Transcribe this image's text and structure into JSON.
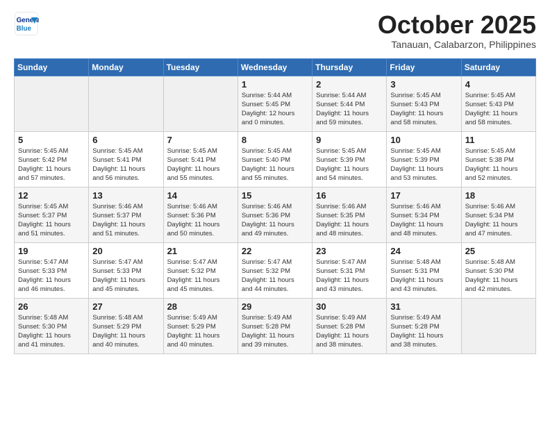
{
  "header": {
    "logo_line1": "General",
    "logo_line2": "Blue",
    "month": "October 2025",
    "location": "Tanauan, Calabarzon, Philippines"
  },
  "days_of_week": [
    "Sunday",
    "Monday",
    "Tuesday",
    "Wednesday",
    "Thursday",
    "Friday",
    "Saturday"
  ],
  "weeks": [
    [
      {
        "day": "",
        "info": ""
      },
      {
        "day": "",
        "info": ""
      },
      {
        "day": "",
        "info": ""
      },
      {
        "day": "1",
        "info": "Sunrise: 5:44 AM\nSunset: 5:45 PM\nDaylight: 12 hours\nand 0 minutes."
      },
      {
        "day": "2",
        "info": "Sunrise: 5:44 AM\nSunset: 5:44 PM\nDaylight: 11 hours\nand 59 minutes."
      },
      {
        "day": "3",
        "info": "Sunrise: 5:45 AM\nSunset: 5:43 PM\nDaylight: 11 hours\nand 58 minutes."
      },
      {
        "day": "4",
        "info": "Sunrise: 5:45 AM\nSunset: 5:43 PM\nDaylight: 11 hours\nand 58 minutes."
      }
    ],
    [
      {
        "day": "5",
        "info": "Sunrise: 5:45 AM\nSunset: 5:42 PM\nDaylight: 11 hours\nand 57 minutes."
      },
      {
        "day": "6",
        "info": "Sunrise: 5:45 AM\nSunset: 5:41 PM\nDaylight: 11 hours\nand 56 minutes."
      },
      {
        "day": "7",
        "info": "Sunrise: 5:45 AM\nSunset: 5:41 PM\nDaylight: 11 hours\nand 55 minutes."
      },
      {
        "day": "8",
        "info": "Sunrise: 5:45 AM\nSunset: 5:40 PM\nDaylight: 11 hours\nand 55 minutes."
      },
      {
        "day": "9",
        "info": "Sunrise: 5:45 AM\nSunset: 5:39 PM\nDaylight: 11 hours\nand 54 minutes."
      },
      {
        "day": "10",
        "info": "Sunrise: 5:45 AM\nSunset: 5:39 PM\nDaylight: 11 hours\nand 53 minutes."
      },
      {
        "day": "11",
        "info": "Sunrise: 5:45 AM\nSunset: 5:38 PM\nDaylight: 11 hours\nand 52 minutes."
      }
    ],
    [
      {
        "day": "12",
        "info": "Sunrise: 5:45 AM\nSunset: 5:37 PM\nDaylight: 11 hours\nand 51 minutes."
      },
      {
        "day": "13",
        "info": "Sunrise: 5:46 AM\nSunset: 5:37 PM\nDaylight: 11 hours\nand 51 minutes."
      },
      {
        "day": "14",
        "info": "Sunrise: 5:46 AM\nSunset: 5:36 PM\nDaylight: 11 hours\nand 50 minutes."
      },
      {
        "day": "15",
        "info": "Sunrise: 5:46 AM\nSunset: 5:36 PM\nDaylight: 11 hours\nand 49 minutes."
      },
      {
        "day": "16",
        "info": "Sunrise: 5:46 AM\nSunset: 5:35 PM\nDaylight: 11 hours\nand 48 minutes."
      },
      {
        "day": "17",
        "info": "Sunrise: 5:46 AM\nSunset: 5:34 PM\nDaylight: 11 hours\nand 48 minutes."
      },
      {
        "day": "18",
        "info": "Sunrise: 5:46 AM\nSunset: 5:34 PM\nDaylight: 11 hours\nand 47 minutes."
      }
    ],
    [
      {
        "day": "19",
        "info": "Sunrise: 5:47 AM\nSunset: 5:33 PM\nDaylight: 11 hours\nand 46 minutes."
      },
      {
        "day": "20",
        "info": "Sunrise: 5:47 AM\nSunset: 5:33 PM\nDaylight: 11 hours\nand 45 minutes."
      },
      {
        "day": "21",
        "info": "Sunrise: 5:47 AM\nSunset: 5:32 PM\nDaylight: 11 hours\nand 45 minutes."
      },
      {
        "day": "22",
        "info": "Sunrise: 5:47 AM\nSunset: 5:32 PM\nDaylight: 11 hours\nand 44 minutes."
      },
      {
        "day": "23",
        "info": "Sunrise: 5:47 AM\nSunset: 5:31 PM\nDaylight: 11 hours\nand 43 minutes."
      },
      {
        "day": "24",
        "info": "Sunrise: 5:48 AM\nSunset: 5:31 PM\nDaylight: 11 hours\nand 43 minutes."
      },
      {
        "day": "25",
        "info": "Sunrise: 5:48 AM\nSunset: 5:30 PM\nDaylight: 11 hours\nand 42 minutes."
      }
    ],
    [
      {
        "day": "26",
        "info": "Sunrise: 5:48 AM\nSunset: 5:30 PM\nDaylight: 11 hours\nand 41 minutes."
      },
      {
        "day": "27",
        "info": "Sunrise: 5:48 AM\nSunset: 5:29 PM\nDaylight: 11 hours\nand 40 minutes."
      },
      {
        "day": "28",
        "info": "Sunrise: 5:49 AM\nSunset: 5:29 PM\nDaylight: 11 hours\nand 40 minutes."
      },
      {
        "day": "29",
        "info": "Sunrise: 5:49 AM\nSunset: 5:28 PM\nDaylight: 11 hours\nand 39 minutes."
      },
      {
        "day": "30",
        "info": "Sunrise: 5:49 AM\nSunset: 5:28 PM\nDaylight: 11 hours\nand 38 minutes."
      },
      {
        "day": "31",
        "info": "Sunrise: 5:49 AM\nSunset: 5:28 PM\nDaylight: 11 hours\nand 38 minutes."
      },
      {
        "day": "",
        "info": ""
      }
    ]
  ]
}
